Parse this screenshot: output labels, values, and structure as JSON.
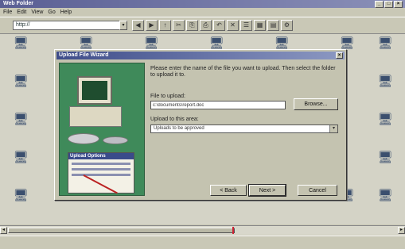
{
  "window": {
    "title": "Web Folder",
    "controls": [
      "_",
      "□",
      "×"
    ]
  },
  "menu": [
    "File",
    "Edit",
    "View",
    "Go",
    "Help"
  ],
  "address": {
    "value": "http://",
    "drop_glyph": "▾"
  },
  "toolbar": {
    "buttons": [
      "◀",
      "▶",
      "↑",
      "✂",
      "⎘",
      "⎙",
      "↶",
      "✕",
      "☰",
      "▦",
      "▤",
      "⚙"
    ]
  },
  "files": [
    {
      "glyph": "🖥",
      "caption": ""
    },
    {
      "glyph": "🖥",
      "caption": ""
    },
    {
      "glyph": "🖥",
      "caption": ""
    },
    {
      "glyph": "🖥",
      "caption": ""
    },
    {
      "glyph": "🖥",
      "caption": ""
    },
    {
      "glyph": "🖥",
      "caption": ""
    },
    {
      "glyph": "🖥",
      "caption": ""
    },
    {
      "glyph": "🖥",
      "caption": ""
    },
    {
      "glyph": "🖥",
      "caption": ""
    },
    {
      "glyph": "🖥",
      "caption": ""
    },
    {
      "glyph": "🖥",
      "caption": ""
    },
    {
      "glyph": "🖥",
      "caption": ""
    },
    {
      "glyph": "🖥",
      "caption": ""
    },
    {
      "glyph": "🖥",
      "caption": ""
    },
    {
      "glyph": "🖥",
      "caption": ""
    },
    {
      "glyph": "🖥",
      "caption": ""
    },
    {
      "glyph": "🖥",
      "caption": ""
    },
    {
      "glyph": "🖥",
      "caption": ""
    },
    {
      "glyph": "🖥",
      "caption": ""
    },
    {
      "glyph": "🖥",
      "caption": ""
    }
  ],
  "dialog": {
    "title": "Upload File Wizard",
    "close": "×",
    "instructions": "Please enter the name of the file you want to upload. Then select the folder to upload it to.",
    "file_label": "File to upload:",
    "file_value": "c:\\documents\\report.doc",
    "browse": "Browse...",
    "folder_label": "Upload to this area:",
    "folder_value": "Uploads to be approved",
    "folder_drop": "▾",
    "back": "< Back",
    "next": "Next >",
    "cancel": "Cancel",
    "art_panel_title": "Upload Options"
  },
  "scroll": {
    "left": "◂",
    "right": "▸"
  },
  "colors": {
    "titlebar": "#5a5f94",
    "dialog_title": "#3f4d8a",
    "wizard_art": "#3f8a5a",
    "scroll_mark": "#cc2233"
  }
}
